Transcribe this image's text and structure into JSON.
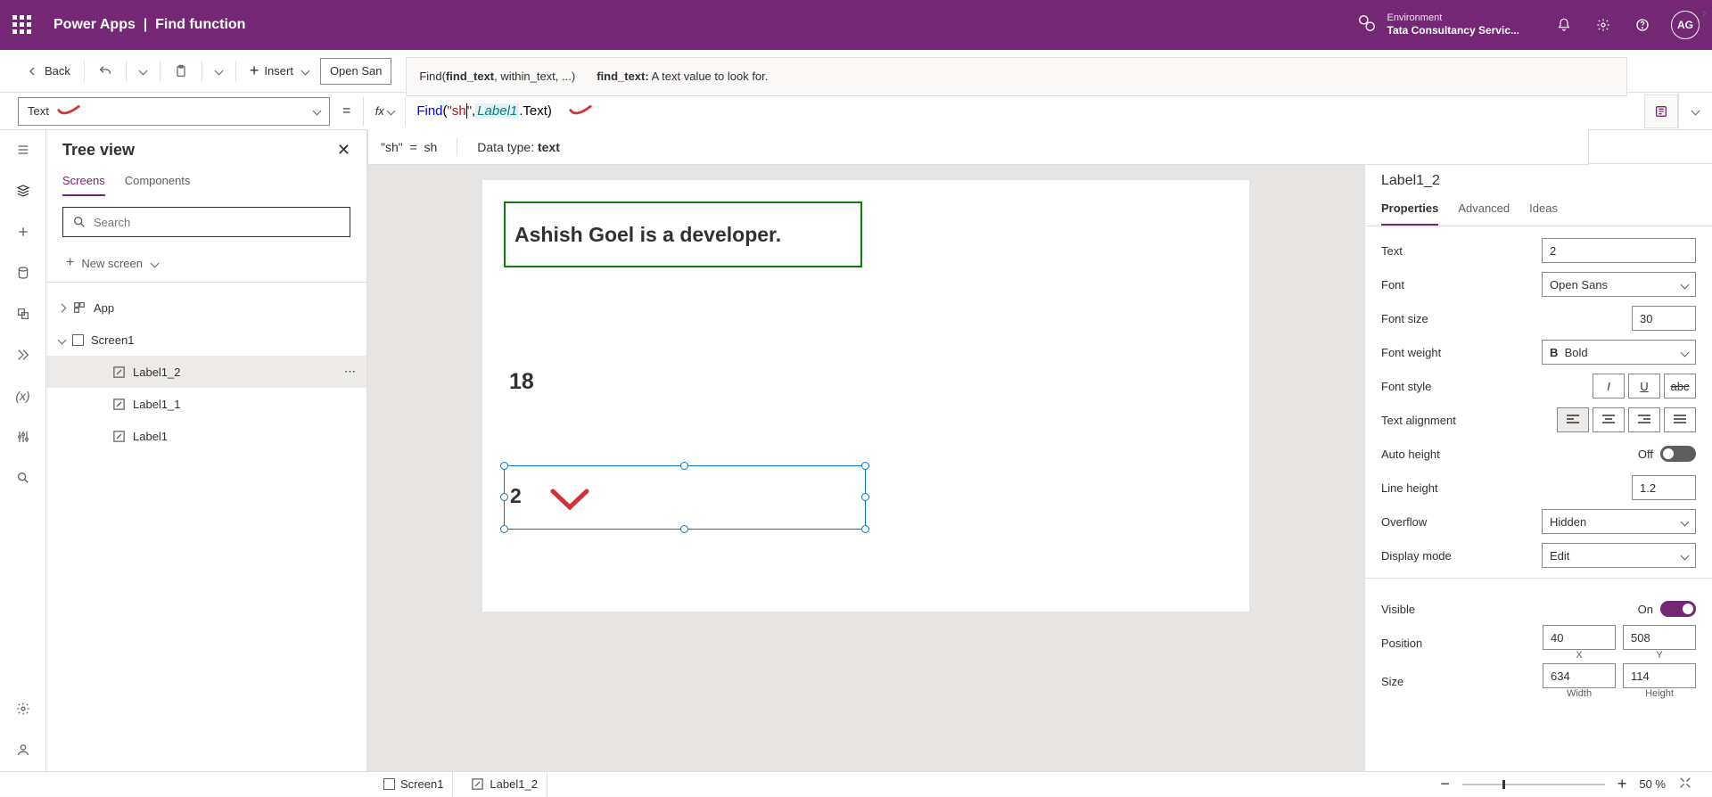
{
  "header": {
    "app_name": "Power Apps",
    "sep": "|",
    "page_name": "Find function",
    "env_label": "Environment",
    "env_value": "Tata Consultancy Servic...",
    "avatar": "AG"
  },
  "toolbar": {
    "back": "Back",
    "insert": "Insert",
    "font": "Open San"
  },
  "propbar": {
    "prop": "Text",
    "formula_fn": "Find",
    "formula_open": "(",
    "formula_str1": "\"sh",
    "formula_str2": "\"",
    "formula_comma": ", ",
    "formula_ref": "Label1",
    "formula_dot": ".Text)",
    "intelli_sig_a": "Find(",
    "intelli_sig_b": "find_text",
    "intelli_sig_c": ", within_text, ...)",
    "intelli_param": "find_text:",
    "intelli_desc": " A text value to look for.",
    "result_l": "\"sh\"",
    "result_eq": "=",
    "result_r": "sh",
    "datatype_l": "Data type: ",
    "datatype_v": "text"
  },
  "tree": {
    "title": "Tree view",
    "tab1": "Screens",
    "tab2": "Components",
    "search_ph": "Search",
    "new_screen": "New screen",
    "items": {
      "app": "App",
      "screen": "Screen1",
      "l12": "Label1_2",
      "l11": "Label1_1",
      "l1": "Label1"
    }
  },
  "canvas": {
    "label1": "Ashish Goel is a developer.",
    "label11": "18",
    "label12": "2"
  },
  "props": {
    "name": "Label1_2",
    "tabs": {
      "p": "Properties",
      "a": "Advanced",
      "i": "Ideas"
    },
    "rows": {
      "text": {
        "lbl": "Text",
        "val": "2"
      },
      "font": {
        "lbl": "Font",
        "val": "Open Sans"
      },
      "fsize": {
        "lbl": "Font size",
        "val": "30"
      },
      "fweight": {
        "lbl": "Font weight",
        "val": "Bold"
      },
      "fstyle": {
        "lbl": "Font style"
      },
      "talign": {
        "lbl": "Text alignment"
      },
      "autoh": {
        "lbl": "Auto height",
        "val": "Off"
      },
      "lineh": {
        "lbl": "Line height",
        "val": "1.2"
      },
      "overflow": {
        "lbl": "Overflow",
        "val": "Hidden"
      },
      "dmode": {
        "lbl": "Display mode",
        "val": "Edit"
      },
      "visible": {
        "lbl": "Visible",
        "val": "On"
      },
      "position": {
        "lbl": "Position",
        "x": "40",
        "y": "508",
        "xl": "X",
        "yl": "Y"
      },
      "size": {
        "lbl": "Size",
        "w": "634",
        "h": "114",
        "wl": "Width",
        "hl": "Height"
      }
    }
  },
  "status": {
    "screen": "Screen1",
    "ctrl": "Label1_2",
    "zoom": "50 %"
  }
}
